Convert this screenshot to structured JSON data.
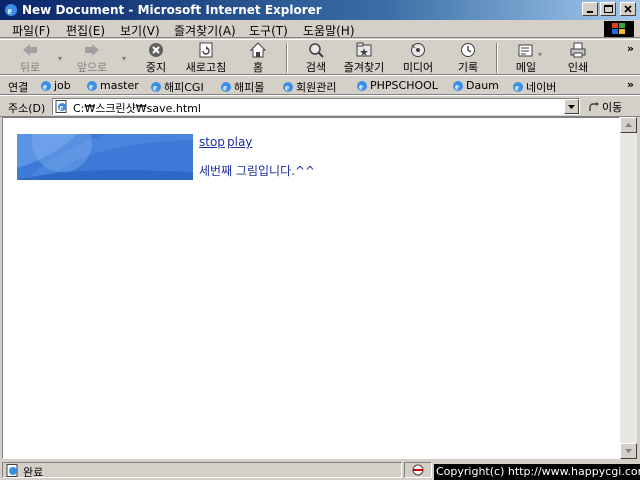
{
  "window": {
    "title": "New Document - Microsoft Internet Explorer"
  },
  "menu": [
    {
      "label": "파일(F)"
    },
    {
      "label": "편집(E)"
    },
    {
      "label": "보기(V)"
    },
    {
      "label": "즐겨찾기(A)"
    },
    {
      "label": "도구(T)"
    },
    {
      "label": "도움말(H)"
    }
  ],
  "toolbar": {
    "back": "뒤로",
    "forward": "앞으로",
    "stop": "중지",
    "refresh": "새로고침",
    "home": "홈",
    "search": "검색",
    "favorites": "즐겨찾기",
    "media": "미디어",
    "history": "기록",
    "mail": "메일",
    "print": "인쇄"
  },
  "links": {
    "label": "연결",
    "items": [
      {
        "label": "job"
      },
      {
        "label": "master"
      },
      {
        "label": "해피CGI"
      },
      {
        "label": "해피몰"
      },
      {
        "label": "회원관리"
      },
      {
        "label": "PHPSCHOOL"
      },
      {
        "label": "Daum"
      },
      {
        "label": "네이버"
      }
    ]
  },
  "address": {
    "label": "주소(D)",
    "value": "C:₩스크린샷₩save.html",
    "go_label": "이동"
  },
  "page": {
    "stop_link": "stop",
    "play_link": "play",
    "message": "세번째 그림입니다.^^"
  },
  "status": {
    "text": "완료",
    "copyright": "Copyright(c) http://www.happycgi.com"
  },
  "colors": {
    "title_bar": "#0a246a",
    "chrome": "#d4d0c8",
    "link_text": "#1e2e9e",
    "banner_blue": "#3d7ad8"
  }
}
